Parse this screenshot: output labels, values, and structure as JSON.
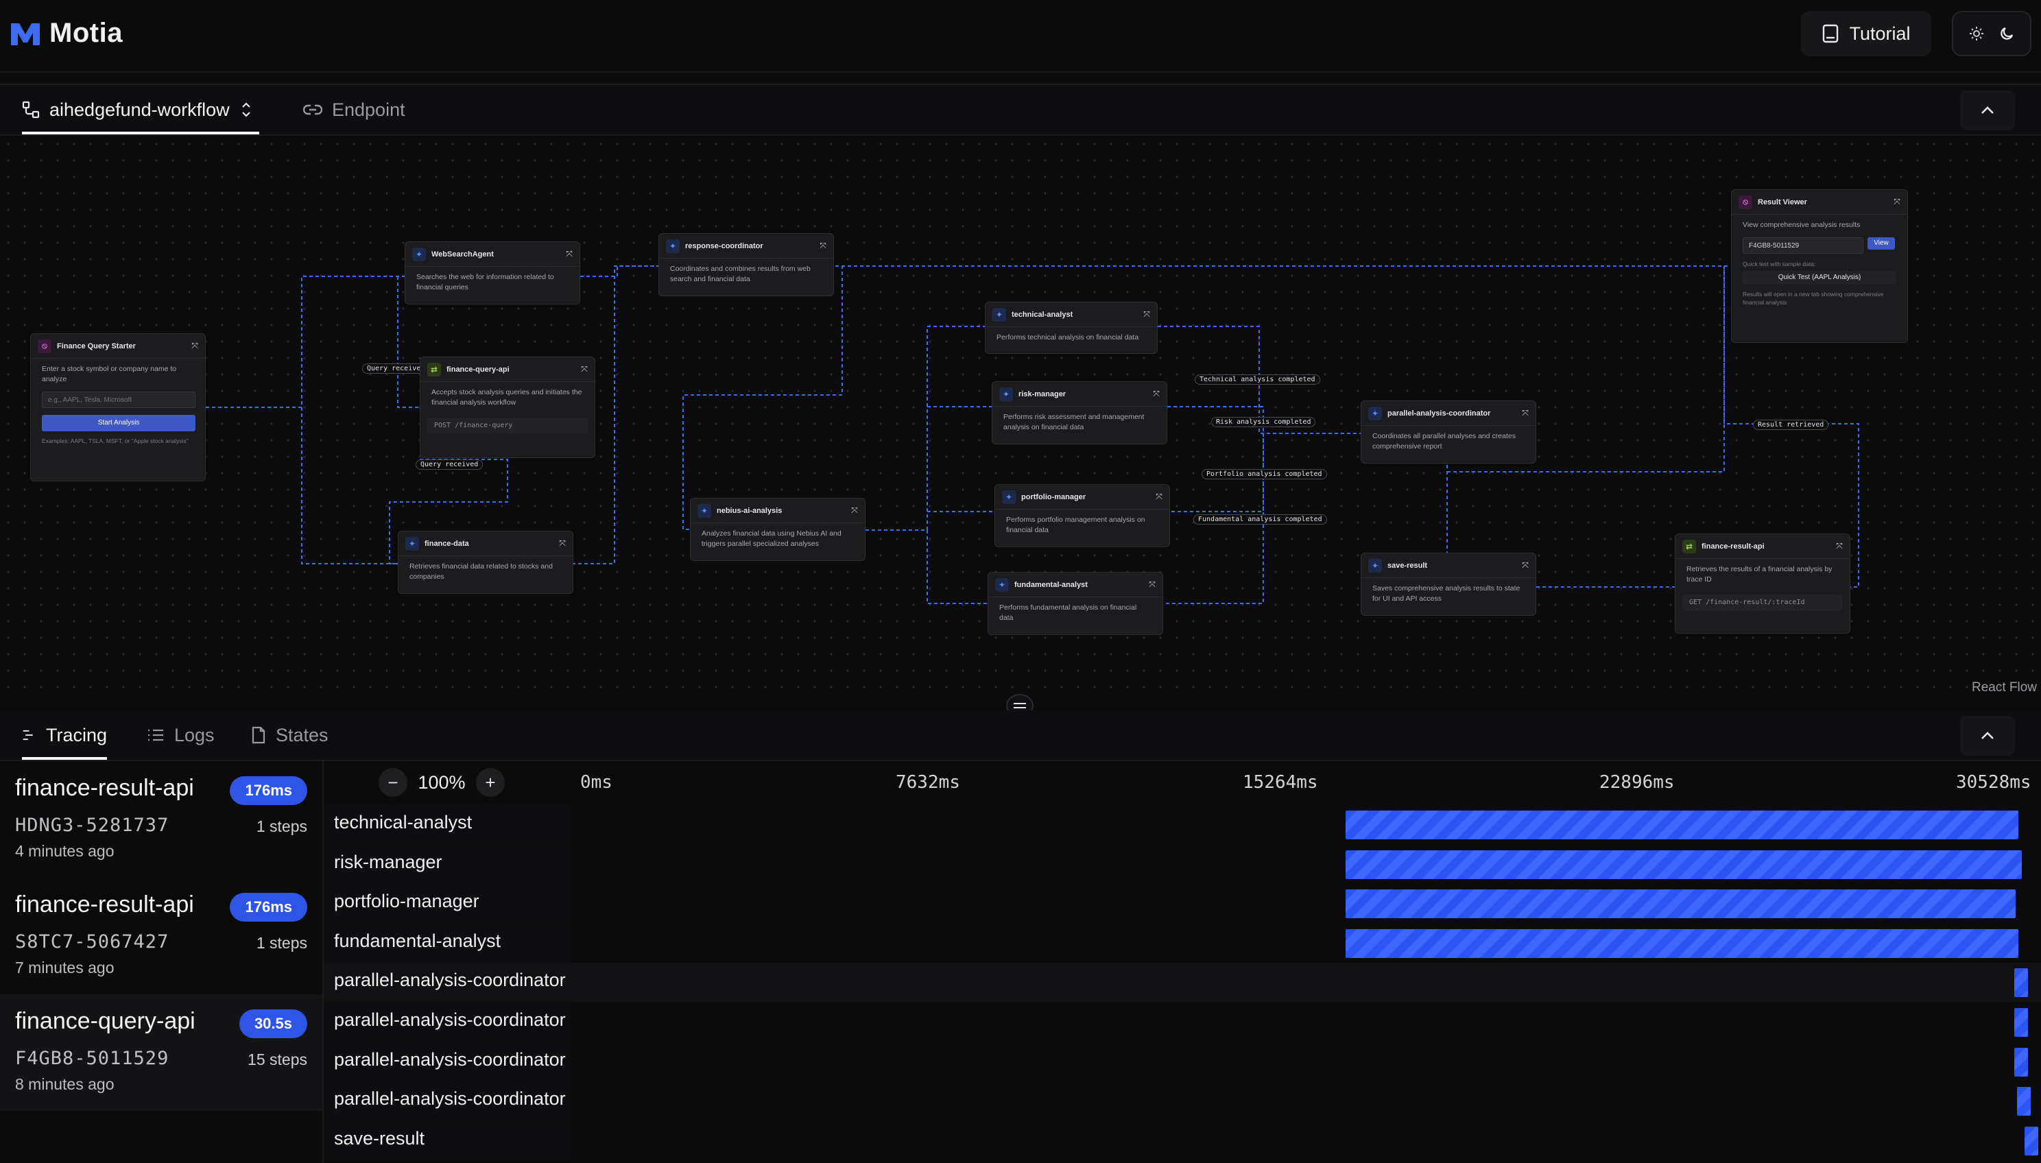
{
  "app": {
    "name": "Motia"
  },
  "header": {
    "tutorial_label": "Tutorial",
    "theme": [
      "light-icon",
      "dark-icon"
    ]
  },
  "flow_tabs": {
    "workflow": "aihedgefund-workflow",
    "endpoint": "Endpoint"
  },
  "flow": {
    "attribution": "React Flow",
    "nodes": {
      "starter": {
        "title": "Finance Query Starter",
        "desc": "Enter a stock symbol or company name to analyze",
        "placeholder": "e.g., AAPL, Tesla, Microsoft",
        "button": "Start Analysis",
        "hint": "Examples: AAPL, TSLA, MSFT, or \"Apple stock analysis\""
      },
      "websearch": {
        "title": "WebSearchAgent",
        "desc": "Searches the web for information related to financial queries"
      },
      "finance_query_api": {
        "title": "finance-query-api",
        "desc": "Accepts stock analysis queries and initiates the financial analysis workflow",
        "route": "POST /finance-query"
      },
      "finance_data": {
        "title": "finance-data",
        "desc": "Retrieves financial data related to stocks and companies"
      },
      "response_coordinator": {
        "title": "response-coordinator",
        "desc": "Coordinates and combines results from web search and financial data"
      },
      "nebius": {
        "title": "nebius-ai-analysis",
        "desc": "Analyzes financial data using Nebius AI and triggers parallel specialized analyses"
      },
      "technical": {
        "title": "technical-analyst",
        "desc": "Performs technical analysis on financial data"
      },
      "risk": {
        "title": "risk-manager",
        "desc": "Performs risk assessment and management analysis on financial data"
      },
      "portfolio": {
        "title": "portfolio-manager",
        "desc": "Performs portfolio management analysis on financial data"
      },
      "fundamental": {
        "title": "fundamental-analyst",
        "desc": "Performs fundamental analysis on financial data"
      },
      "parallel": {
        "title": "parallel-analysis-coordinator",
        "desc": "Coordinates all parallel analyses and creates comprehensive report"
      },
      "save_result": {
        "title": "save-result",
        "desc": "Saves comprehensive analysis results to state for UI and API access"
      },
      "finance_result_api": {
        "title": "finance-result-api",
        "desc": "Retrieves the results of a financial analysis by trace ID",
        "route": "GET /finance-result/:traceId"
      },
      "result_viewer": {
        "title": "Result Viewer",
        "desc": "View comprehensive analysis results",
        "input_value": "F4GB8-5011529",
        "view_button": "View",
        "quick_label": "Quick test with sample data:",
        "quick_button": "Quick Test (AAPL Analysis)",
        "note": "Results will open in a new tab showing comprehensive financial analysis"
      }
    },
    "edge_labels": {
      "query_received_1": "Query received",
      "query_received_2": "Query received",
      "technical_done": "Technical analysis completed",
      "risk_done": "Risk analysis completed",
      "portfolio_done": "Portfolio analysis completed",
      "fundamental_done": "Fundamental analysis completed",
      "result_retrieved": "Result retrieved"
    }
  },
  "bottom_tabs": {
    "tracing": "Tracing",
    "logs": "Logs",
    "states": "States"
  },
  "traces": [
    {
      "name": "finance-result-api",
      "duration": "176ms",
      "id": "HDNG3-5281737",
      "steps": "1 steps",
      "time": "4 minutes ago"
    },
    {
      "name": "finance-result-api",
      "duration": "176ms",
      "id": "S8TC7-5067427",
      "steps": "1 steps",
      "time": "7 minutes ago"
    },
    {
      "name": "finance-query-api",
      "duration": "30.5s",
      "id": "F4GB8-5011529",
      "steps": "15 steps",
      "time": "8 minutes ago"
    }
  ],
  "timeline": {
    "zoom": "100%",
    "ticks": [
      "0ms",
      "7632ms",
      "15264ms",
      "22896ms",
      "30528ms"
    ],
    "rows": [
      {
        "label": "technical-analyst",
        "start": 0.526,
        "end": 0.994
      },
      {
        "label": "risk-manager",
        "start": 0.526,
        "end": 0.996
      },
      {
        "label": "portfolio-manager",
        "start": 0.526,
        "end": 0.992
      },
      {
        "label": "fundamental-analyst",
        "start": 0.526,
        "end": 0.994
      },
      {
        "label": "parallel-analysis-coordinator",
        "start": 0.991,
        "end": 1.0
      },
      {
        "label": "parallel-analysis-coordinator",
        "start": 0.991,
        "end": 1.0
      },
      {
        "label": "parallel-analysis-coordinator",
        "start": 0.991,
        "end": 1.0
      },
      {
        "label": "parallel-analysis-coordinator",
        "start": 0.993,
        "end": 1.0
      },
      {
        "label": "save-result",
        "start": 0.998,
        "end": 1.0
      }
    ]
  }
}
